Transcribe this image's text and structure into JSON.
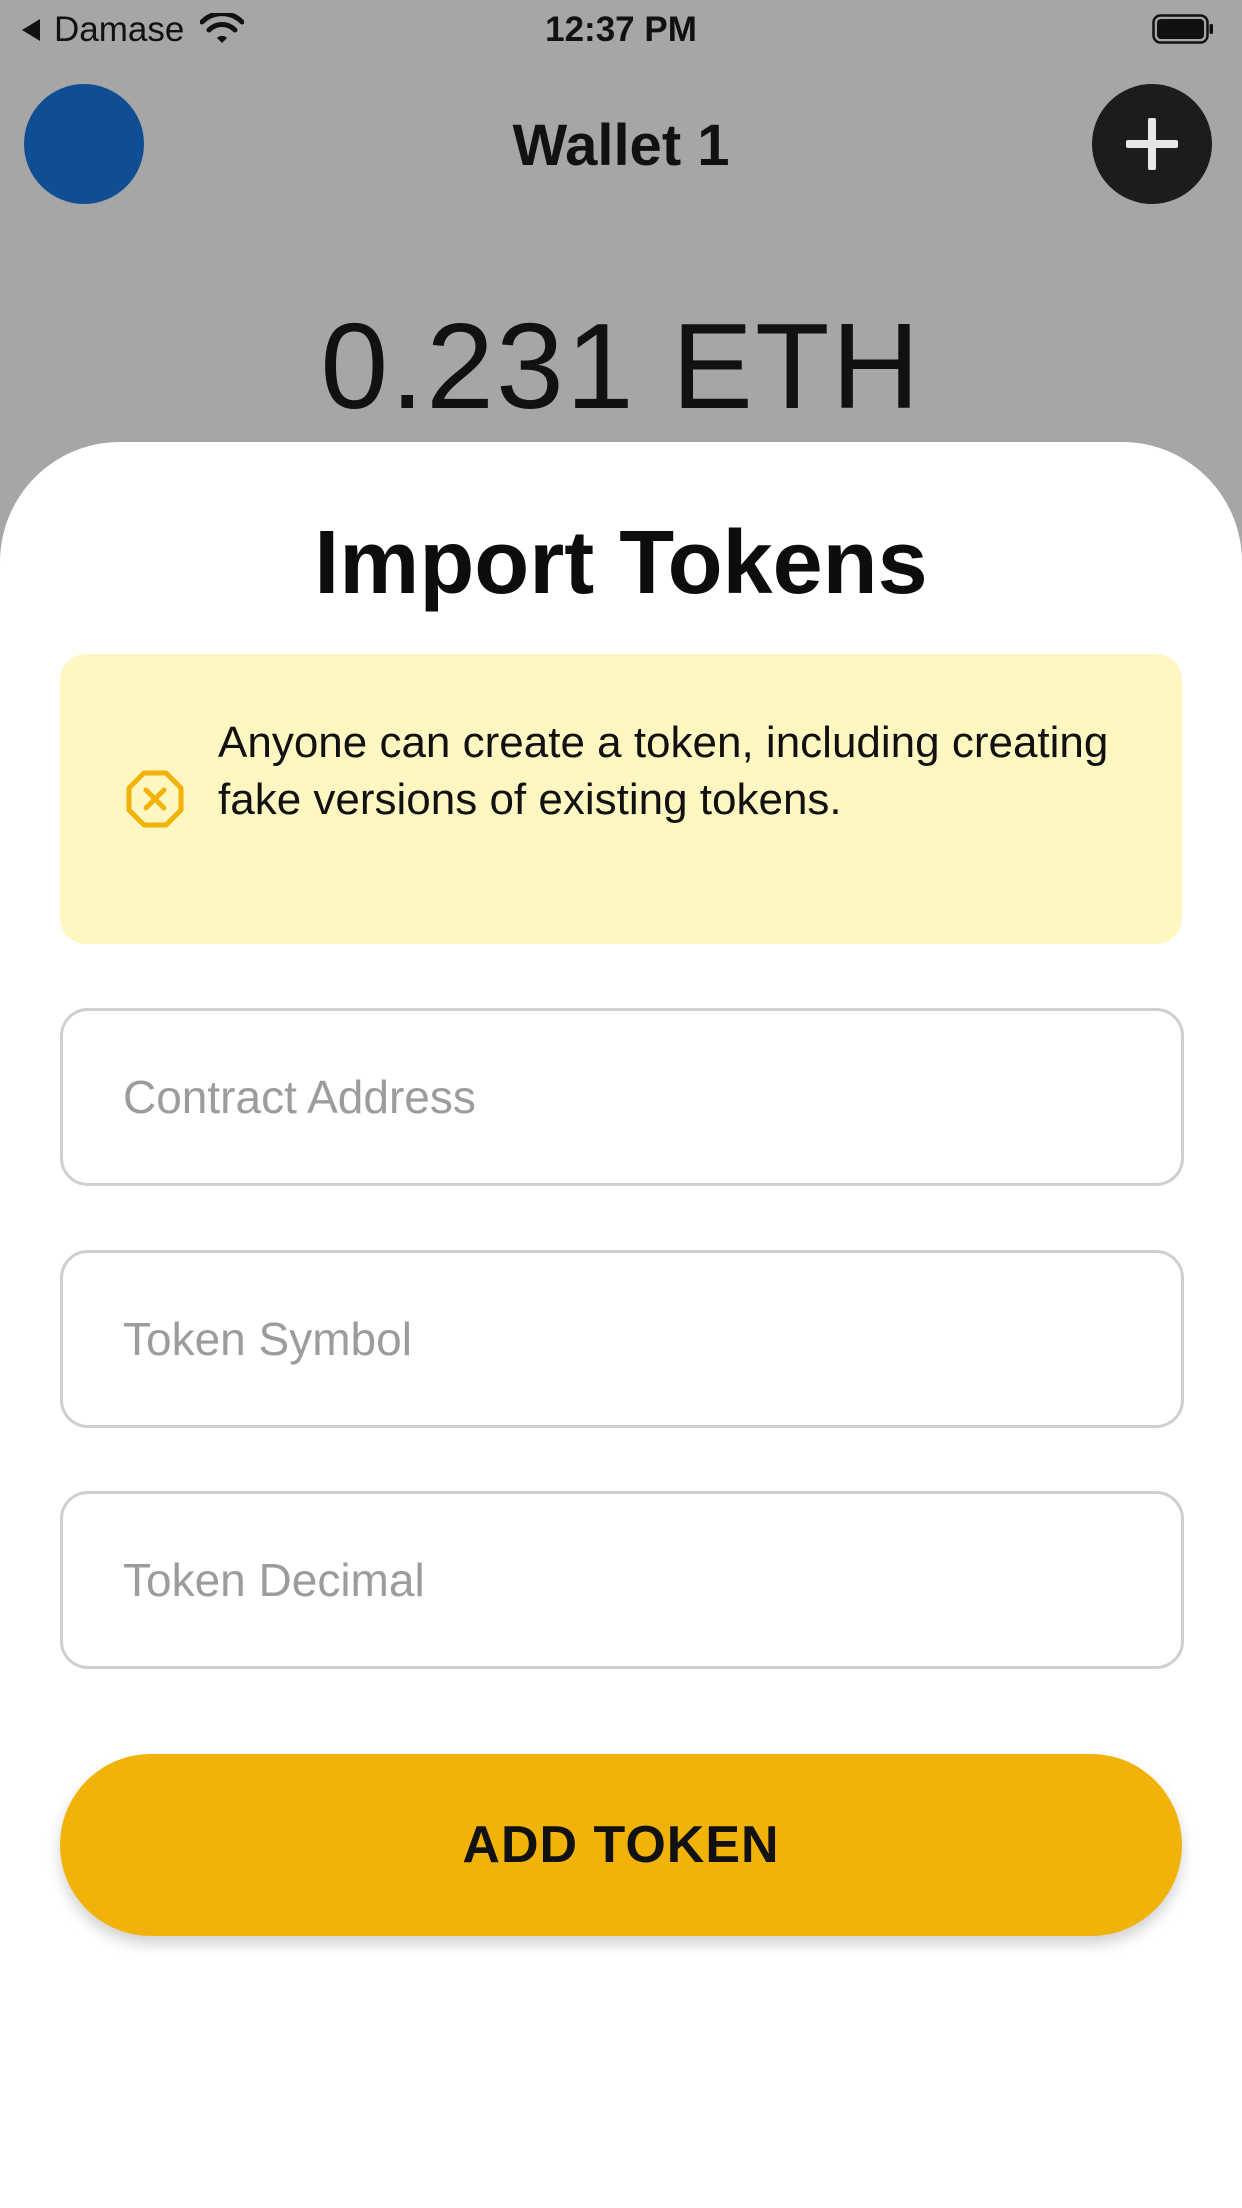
{
  "status_bar": {
    "back_app": "Damase",
    "time": "12:37 PM"
  },
  "header": {
    "wallet_name": "Wallet 1",
    "balance": "0.231 ETH"
  },
  "sheet": {
    "title": "Import Tokens",
    "warning_text": "Anyone can create a token, including creating fake versions of existing tokens.",
    "fields": {
      "contract_address_placeholder": "Contract Address",
      "token_symbol_placeholder": "Token Symbol",
      "token_decimal_placeholder": "Token Decimal"
    },
    "submit_label": "ADD TOKEN"
  },
  "colors": {
    "backdrop": "#a6a6a6",
    "avatar": "#0f4e93",
    "accent": "#f1b20a",
    "warning_bg": "#fff7c2"
  },
  "icons": {
    "back": "back-caret-icon",
    "wifi": "wifi-icon",
    "battery": "battery-icon",
    "add": "plus-icon",
    "warning": "warning-octagon-x-icon"
  }
}
